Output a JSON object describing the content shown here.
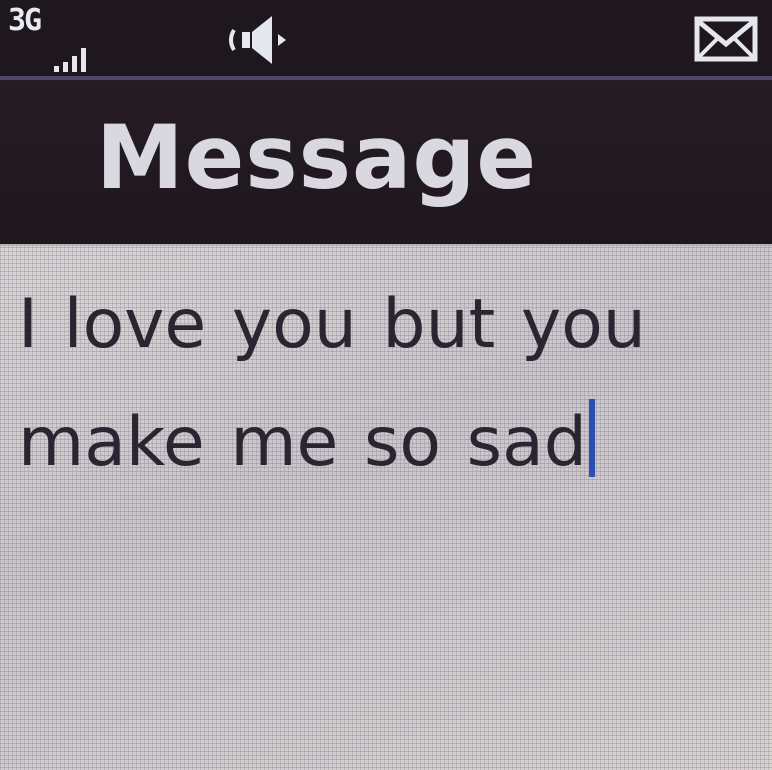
{
  "status_bar": {
    "network_type": "3G",
    "signal_icon": "signal-bars-icon",
    "sound_icon": "speaker-icon",
    "message_icon": "envelope-icon"
  },
  "header": {
    "title": "Message"
  },
  "compose": {
    "text": "I love you but you make me so sad",
    "cursor_color": "#2a4fb0"
  },
  "colors": {
    "header_bg": "#221a20",
    "message_bg": "#cdcbc9",
    "title_text": "#d9d8e0",
    "message_text": "#2a2530"
  }
}
